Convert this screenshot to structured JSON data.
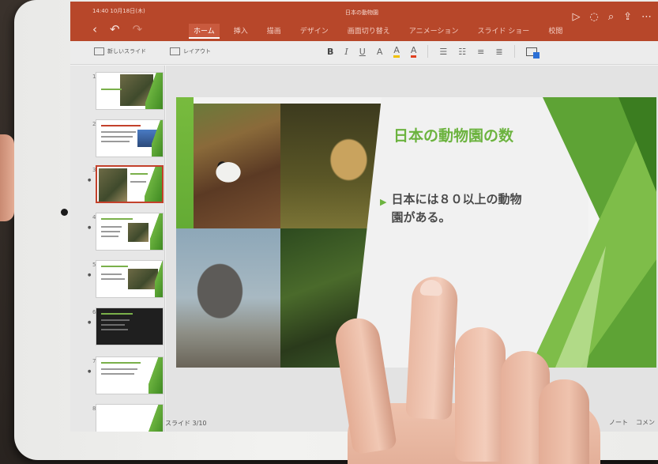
{
  "status_bar": {
    "time_date": "14:40 10月18日(木)"
  },
  "document": {
    "title": "日本の動物園"
  },
  "ribbon": {
    "tabs": [
      "ホーム",
      "挿入",
      "描画",
      "デザイン",
      "画面切り替え",
      "アニメーション",
      "スライド ショー",
      "校閲"
    ],
    "active_tab": "ホーム",
    "nav_icons": [
      "chevron-left-icon",
      "undo-icon",
      "redo-icon"
    ],
    "right_icons": [
      "play-icon",
      "lightbulb-icon",
      "search-icon",
      "share-icon",
      "more-icon"
    ]
  },
  "toolbar": {
    "new_slide_label": "新しいスライド",
    "layout_label": "レイアウト",
    "bold": "B",
    "italic": "I",
    "underline": "U",
    "font_size": "A",
    "highlight": "A",
    "font_color": "A"
  },
  "thumbnails": [
    {
      "number": "1"
    },
    {
      "number": "2"
    },
    {
      "number": "3",
      "selected": true
    },
    {
      "number": "4"
    },
    {
      "number": "5"
    },
    {
      "number": "6"
    },
    {
      "number": "7"
    },
    {
      "number": "8"
    }
  ],
  "slide_counter": "スライド 3/10",
  "slide": {
    "title": "日本の動物園の数",
    "bullet": "日本には８０以上の動物園がある。"
  },
  "bottom_bar": {
    "notes_label": "ノート",
    "comments_label": "コメン"
  },
  "colors": {
    "ribbon_red": "#b7472a",
    "slide_green": "#6cb33f",
    "selected_thumb_border": "#c3412b"
  }
}
